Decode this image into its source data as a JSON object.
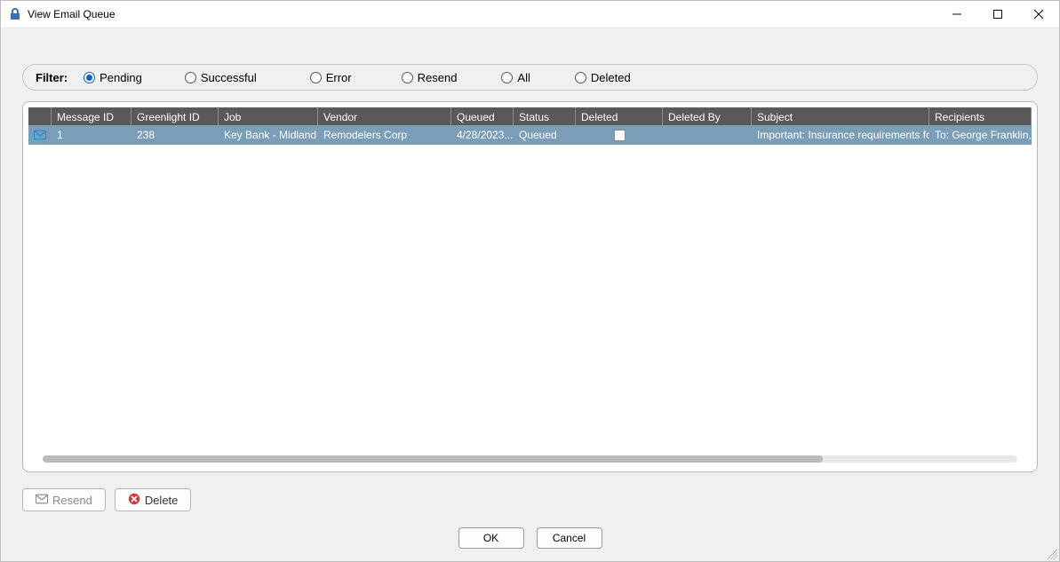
{
  "window": {
    "title": "View Email Queue"
  },
  "filter": {
    "label": "Filter:",
    "options": {
      "pending": {
        "label": "Pending",
        "checked": true
      },
      "successful": {
        "label": "Successful",
        "checked": false
      },
      "error": {
        "label": "Error",
        "checked": false
      },
      "resend": {
        "label": "Resend",
        "checked": false
      },
      "all": {
        "label": "All",
        "checked": false
      },
      "deleted": {
        "label": "Deleted",
        "checked": false
      }
    }
  },
  "grid": {
    "columns": {
      "icon": "",
      "message_id": "Message ID",
      "greenlight_id": "Greenlight ID",
      "job": "Job",
      "vendor": "Vendor",
      "queued": "Queued",
      "status": "Status",
      "deleted": "Deleted",
      "deleted_by": "Deleted By",
      "subject": "Subject",
      "recipients": "Recipients"
    },
    "rows": [
      {
        "message_id": "1",
        "greenlight_id": "238",
        "job": "Key Bank - Midland",
        "vendor": "Remodelers Corp",
        "queued": "4/28/2023...",
        "status": "Queued",
        "deleted": false,
        "deleted_by": "",
        "subject": "Important: Insurance requirements for o...",
        "recipients": "To: George Franklin, Ja"
      }
    ]
  },
  "actions": {
    "resend": "Resend",
    "delete": "Delete"
  },
  "dialog": {
    "ok": "OK",
    "cancel": "Cancel"
  }
}
